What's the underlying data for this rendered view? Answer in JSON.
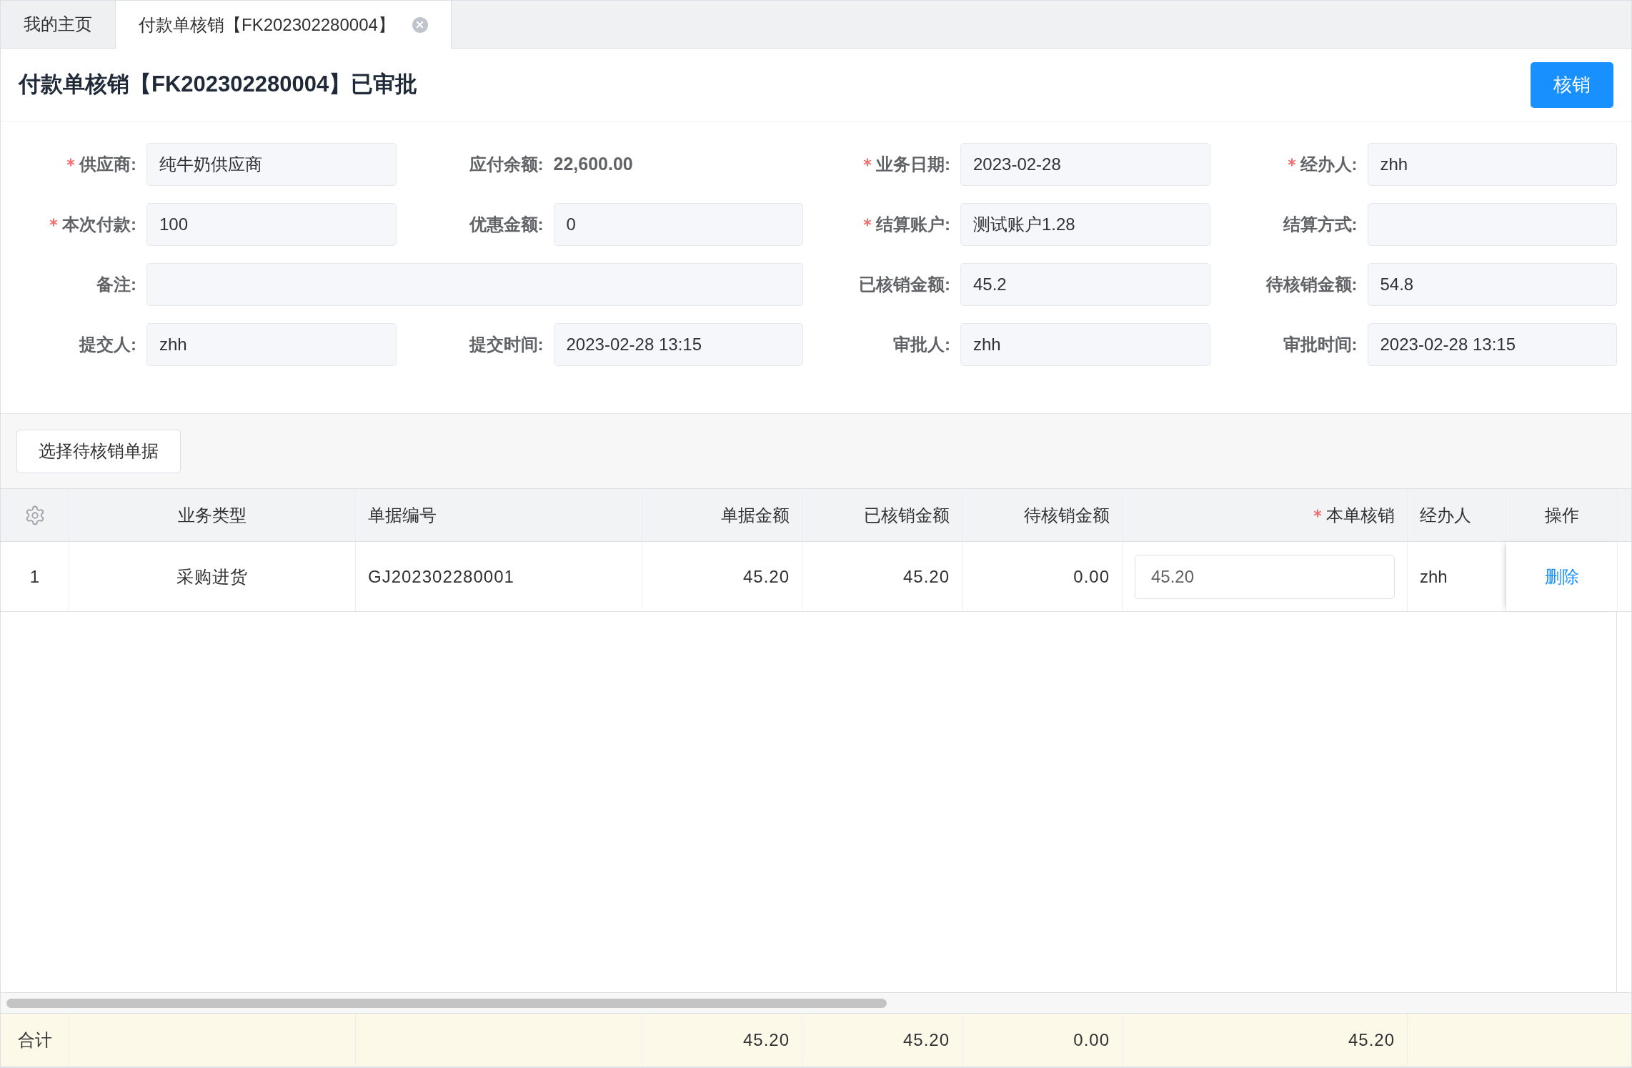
{
  "tabs": [
    {
      "label": "我的主页",
      "selected": false,
      "closable": false
    },
    {
      "label": "付款单核销【FK202302280004】",
      "selected": true,
      "closable": true
    }
  ],
  "header": {
    "title": "付款单核销【FK202302280004】已审批",
    "action_button": "核销"
  },
  "form": {
    "fields": [
      {
        "kind": "input",
        "label": "供应商:",
        "required": true,
        "value": "纯牛奶供应商"
      },
      {
        "kind": "text",
        "label": "应付余额:",
        "required": false,
        "value": "22,600.00"
      },
      {
        "kind": "input",
        "label": "业务日期:",
        "required": true,
        "value": "2023-02-28"
      },
      {
        "kind": "input",
        "label": "经办人:",
        "required": true,
        "value": "zhh"
      },
      {
        "kind": "input",
        "label": "本次付款:",
        "required": true,
        "value": "100"
      },
      {
        "kind": "input",
        "label": "优惠金额:",
        "required": false,
        "value": "0"
      },
      {
        "kind": "input",
        "label": "结算账户:",
        "required": true,
        "value": "测试账户1.28"
      },
      {
        "kind": "input",
        "label": "结算方式:",
        "required": false
      },
      {
        "kind": "wide",
        "label": "备注:",
        "required": false
      },
      {
        "kind": "input",
        "label": "已核销金额:",
        "required": false,
        "value": "45.2"
      },
      {
        "kind": "input",
        "label": "待核销金额:",
        "required": false,
        "value": "54.8"
      },
      {
        "kind": "input",
        "label": "提交人:",
        "required": false,
        "value": "zhh"
      },
      {
        "kind": "input",
        "label": "提交时间:",
        "required": false,
        "value": "2023-02-28 13:15"
      },
      {
        "kind": "input",
        "label": "审批人:",
        "required": false,
        "value": "zhh"
      },
      {
        "kind": "input",
        "label": "审批时间:",
        "required": false,
        "value": "2023-02-28 13:15"
      }
    ]
  },
  "toolbar": {
    "button": "选择待核销单据"
  },
  "table": {
    "columns": [
      {
        "label": "业务类型",
        "required": false
      },
      {
        "label": "单据编号",
        "required": false
      },
      {
        "label": "单据金额",
        "required": false
      },
      {
        "label": "已核销金额",
        "required": false
      },
      {
        "label": "待核销金额",
        "required": false
      },
      {
        "label": "本单核销",
        "required": true
      },
      {
        "label": "经办人",
        "required": false
      },
      {
        "label": "操作",
        "required": false
      }
    ],
    "rows": [
      {
        "index": "1",
        "type": "采购进货",
        "number": "GJ202302280001",
        "amount": "45.20",
        "written_off": "45.20",
        "pending": "0.00",
        "this_write_off": "45.20",
        "handler": "zhh",
        "action": "删除"
      }
    ],
    "footer": {
      "label": "合计",
      "amount": "45.20",
      "written_off": "45.20",
      "pending": "0.00",
      "this_write_off": "45.20"
    }
  }
}
